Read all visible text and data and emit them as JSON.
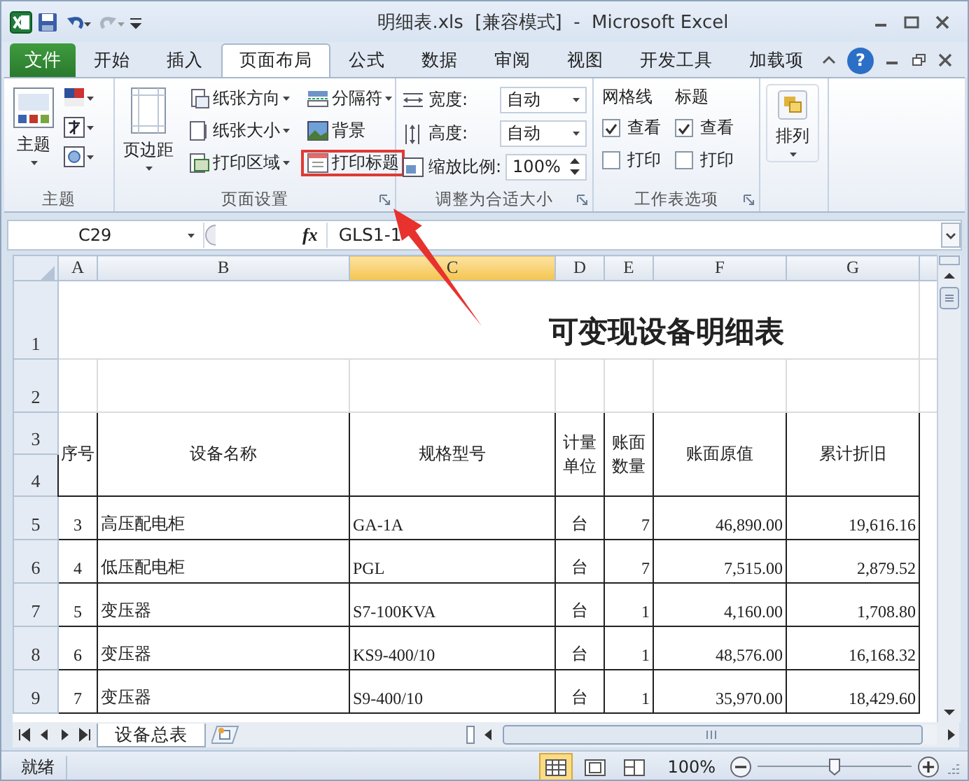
{
  "window": {
    "title": "明细表.xls  [兼容模式]  -  Microsoft Excel"
  },
  "file_tab": "文件",
  "tabs": [
    {
      "label": "开始",
      "selected": false
    },
    {
      "label": "插入",
      "selected": false
    },
    {
      "label": "页面布局",
      "selected": true
    },
    {
      "label": "公式",
      "selected": false
    },
    {
      "label": "数据",
      "selected": false
    },
    {
      "label": "审阅",
      "selected": false
    },
    {
      "label": "视图",
      "selected": false
    },
    {
      "label": "开发工具",
      "selected": false
    },
    {
      "label": "加载项",
      "selected": false
    }
  ],
  "help": "?",
  "ribbon": {
    "themes": {
      "label": "主题",
      "button": "主题"
    },
    "page_setup": {
      "label": "页面设置",
      "margins": "页边距",
      "commands": [
        {
          "label": "纸张方向",
          "dropdown": true,
          "highlighted": false
        },
        {
          "label": "分隔符",
          "dropdown": true,
          "highlighted": false
        },
        {
          "label": "纸张大小",
          "dropdown": true,
          "highlighted": false
        },
        {
          "label": "背景",
          "dropdown": false,
          "highlighted": false
        },
        {
          "label": "打印区域",
          "dropdown": true,
          "highlighted": false
        },
        {
          "label": "打印标题",
          "dropdown": false,
          "highlighted": true
        }
      ]
    },
    "scale": {
      "label": "调整为合适大小",
      "fields": [
        {
          "kind": "dropdown",
          "label": "宽度:",
          "value": "自动"
        },
        {
          "kind": "dropdown",
          "label": "高度:",
          "value": "自动"
        },
        {
          "kind": "spinner",
          "label": "缩放比例:",
          "value": "100%"
        }
      ]
    },
    "sheet_options": {
      "label": "工作表选项",
      "sections": [
        {
          "title": "网格线",
          "options": [
            {
              "label": "查看",
              "checked": true
            },
            {
              "label": "打印",
              "checked": false
            }
          ]
        },
        {
          "title": "标题",
          "options": [
            {
              "label": "查看",
              "checked": true
            },
            {
              "label": "打印",
              "checked": false
            }
          ]
        }
      ]
    },
    "arrange": {
      "button": "排列"
    }
  },
  "formula_bar": {
    "name_box": "C29",
    "function_button": "fx",
    "value": "GLS1-1"
  },
  "sheet": {
    "columns": [
      {
        "label": "A",
        "selected": false
      },
      {
        "label": "B",
        "selected": false
      },
      {
        "label": "C",
        "selected": true
      },
      {
        "label": "D",
        "selected": false
      },
      {
        "label": "E",
        "selected": false
      },
      {
        "label": "F",
        "selected": false
      },
      {
        "label": "G",
        "selected": false
      }
    ],
    "title_row": {
      "row": "1",
      "text": "可变现设备明细表"
    },
    "blank_row": {
      "row": "2"
    },
    "header_rows": [
      "3",
      "4"
    ],
    "header_cells": [
      "序号",
      "设备名称",
      "规格型号",
      "计量单位",
      "账面数量",
      "账面原值",
      "累计折旧"
    ],
    "rows": [
      {
        "row": "5",
        "cells": [
          "3",
          "高压配电柜",
          "GA-1A",
          "台",
          "7",
          "46,890.00",
          "19,616.16"
        ]
      },
      {
        "row": "6",
        "cells": [
          "4",
          "低压配电柜",
          "PGL",
          "台",
          "7",
          "7,515.00",
          "2,879.52"
        ]
      },
      {
        "row": "7",
        "cells": [
          "5",
          "变压器",
          "S7-100KVA",
          "台",
          "1",
          "4,160.00",
          "1,708.80"
        ]
      },
      {
        "row": "8",
        "cells": [
          "6",
          "变压器",
          "KS9-400/10",
          "台",
          "1",
          "48,576.00",
          "16,168.32"
        ]
      },
      {
        "row": "9",
        "cells": [
          "7",
          "变压器",
          "S9-400/10",
          "台",
          "1",
          "35,970.00",
          "18,429.60"
        ]
      }
    ]
  },
  "sheet_tabs": [
    {
      "label": "设备总表",
      "selected": true
    }
  ],
  "status_bar": {
    "text": "就绪",
    "views": [
      {
        "kind": "normal",
        "selected": true
      },
      {
        "kind": "page_layout",
        "selected": false
      },
      {
        "kind": "page_break",
        "selected": false
      }
    ],
    "zoom": "100%",
    "zoom_slider": {
      "level": 0.5
    }
  }
}
